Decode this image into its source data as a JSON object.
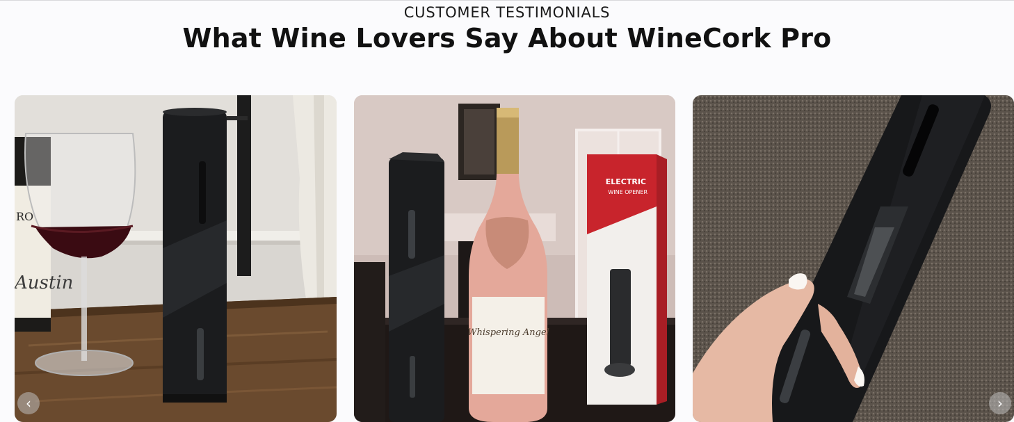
{
  "section": {
    "eyebrow": "CUSTOMER TESTIMONIALS",
    "title": "What Wine Lovers Say About WineCork Pro"
  },
  "carousel": {
    "prev_icon": "chevron-left-icon",
    "next_icon": "chevron-right-icon",
    "prev_glyph": "‹",
    "next_glyph": "›",
    "slides": [
      {
        "name": "photo-opener-with-wine-glass",
        "bottle_label": "Austin",
        "bottle_label_top": "RO"
      },
      {
        "name": "photo-opener-with-rose-bottle",
        "bottle_label": "Whispering Angel",
        "box_label_1": "ELECTRIC",
        "box_label_2": "WINE OPENER"
      },
      {
        "name": "photo-opener-in-hand"
      }
    ]
  },
  "colors": {
    "background": "#fbfbfd",
    "heading": "#111111",
    "opener": "#1b1c1e"
  }
}
